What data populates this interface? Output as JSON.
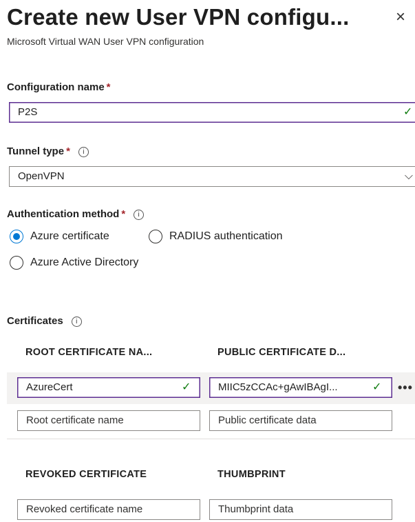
{
  "panel": {
    "title": "Create new User VPN configu...",
    "subtitle": "Microsoft Virtual WAN User VPN configuration",
    "close_icon": "×"
  },
  "config_name": {
    "label": "Configuration name",
    "required_mark": "*",
    "value": "P2S",
    "valid_icon": "✓"
  },
  "tunnel_type": {
    "label": "Tunnel type",
    "required_mark": "*",
    "info_icon": "i",
    "value": "OpenVPN",
    "dropdown_icon": "⌵"
  },
  "auth_method": {
    "label": "Authentication method",
    "required_mark": "*",
    "info_icon": "i",
    "options": [
      "Azure certificate",
      "RADIUS authentication",
      "Azure Active Directory"
    ],
    "selected": "Azure certificate"
  },
  "certificates": {
    "label": "Certificates",
    "info_icon": "i",
    "root_headers": [
      "ROOT CERTIFICATE NA...",
      "PUBLIC CERTIFICATE D..."
    ],
    "root_rows": [
      {
        "name": "AzureCert",
        "data": "MIIC5zCCAc+gAwIBAgI...",
        "valid_icon": "✓",
        "more_icon": "•••"
      }
    ],
    "root_placeholders": {
      "name": "Root certificate name",
      "data": "Public certificate data"
    },
    "revoked_headers": [
      "REVOKED CERTIFICATE",
      "THUMBPRINT"
    ],
    "revoked_placeholders": {
      "name": "Revoked certificate name",
      "thumbprint": "Thumbprint data"
    }
  },
  "colors": {
    "accent": "#0078d4",
    "focus_border": "#5c2d91",
    "valid_check": "#107c10",
    "required": "#a4262c"
  }
}
